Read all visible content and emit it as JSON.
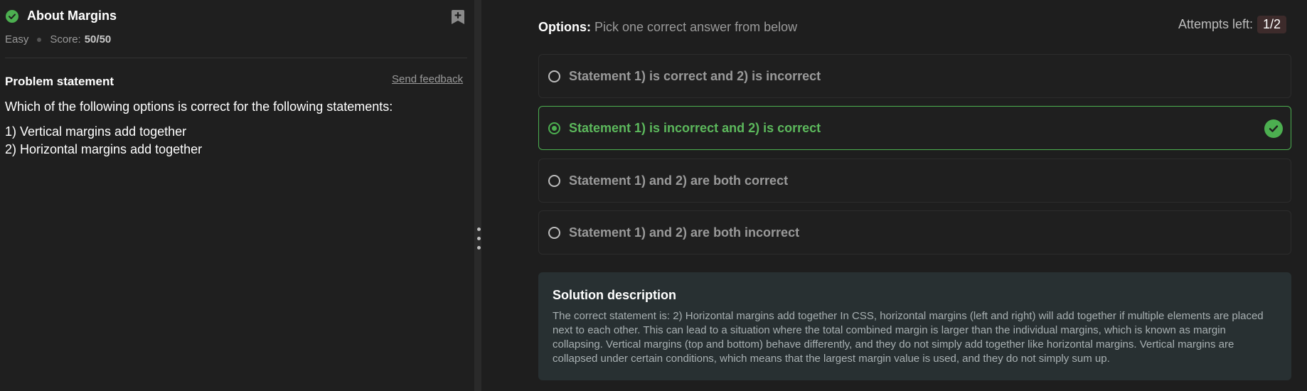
{
  "problem": {
    "title": "About Margins",
    "difficulty": "Easy",
    "score_label": "Score:",
    "score_value": "50/50",
    "statement_heading": "Problem statement",
    "feedback_link": "Send feedback",
    "question": "Which of the following options is correct for the following statements:",
    "statements": [
      "1) Vertical margins add together",
      "2) Horizontal margins add together"
    ]
  },
  "options": {
    "label": "Options:",
    "hint": "Pick one correct answer from below",
    "attempts_label": "Attempts left:",
    "attempts_value": "1/2",
    "items": [
      {
        "label": "Statement 1) is correct and 2) is incorrect",
        "selected": false
      },
      {
        "label": "Statement 1) is incorrect and 2) is correct",
        "selected": true
      },
      {
        "label": "Statement 1) and 2) are both correct",
        "selected": false
      },
      {
        "label": "Statement 1) and 2) are both incorrect",
        "selected": false
      }
    ]
  },
  "solution": {
    "title": "Solution description",
    "text": "The correct statement is: 2) Horizontal margins add together In CSS, horizontal margins (left and right) will add together if multiple elements are placed next to each other. This can lead to a situation where the total combined margin is larger than the individual margins, which is known as margin collapsing. Vertical margins (top and bottom) behave differently, and they do not simply add together like horizontal margins. Vertical margins are collapsed under certain conditions, which means that the largest margin value is used, and they do not simply sum up."
  },
  "colors": {
    "accent_green": "#4caf50",
    "background": "#1e1e1e",
    "solution_bg": "#283032"
  },
  "icons": [
    "check-circle-icon",
    "bookmark-add-icon",
    "radio-icon",
    "drag-handle-icon"
  ]
}
